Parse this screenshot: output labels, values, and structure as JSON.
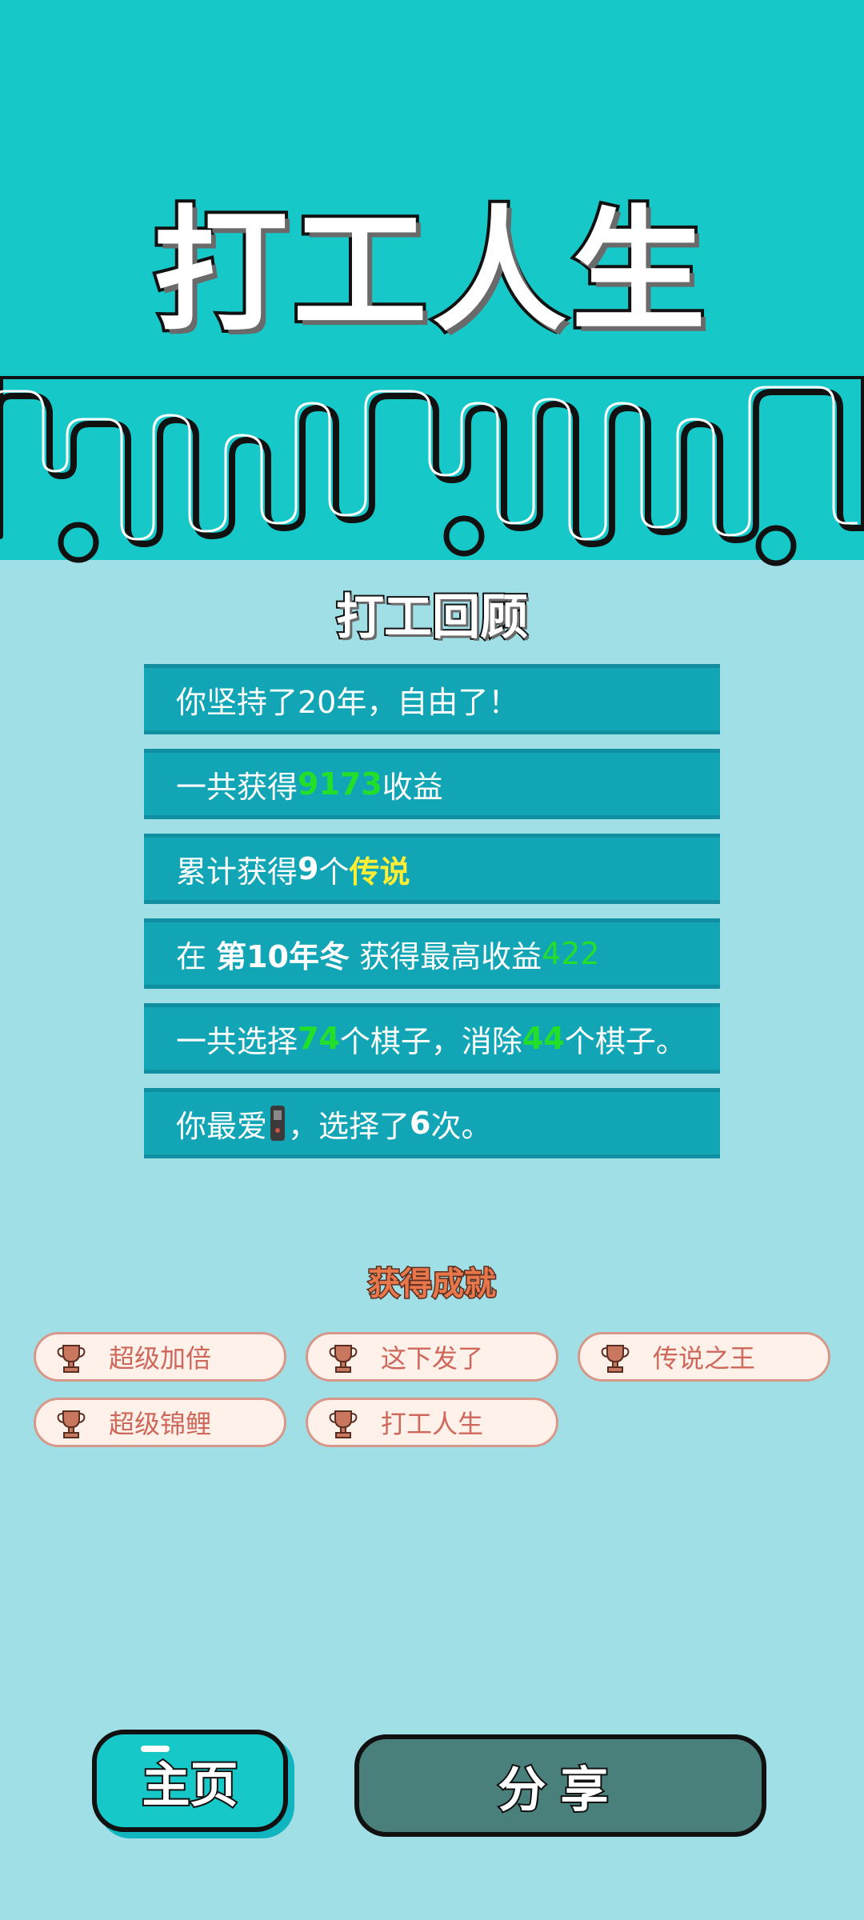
{
  "header": {
    "title": "打工人生"
  },
  "review": {
    "title": "打工回顾",
    "row1": {
      "text": "你坚持了20年，自由了！"
    },
    "row2": {
      "prefix": "一共获得",
      "value": "9173",
      "suffix": "收益"
    },
    "row3": {
      "prefix": "累计获得",
      "count": "9",
      "mid": "个",
      "rarity": "传说"
    },
    "row4": {
      "prefix": "在 ",
      "season": "第10年冬",
      "mid": " 获得最高收益",
      "value": "422"
    },
    "row5": {
      "prefix": "一共选择",
      "chosen": "74",
      "mid": "个棋子，消除",
      "removed": "44",
      "suffix": "个棋子。"
    },
    "row6": {
      "prefix": "你最爱",
      "icon": "phone-icon",
      "mid": "，选择了",
      "count": "6",
      "suffix": "次。"
    }
  },
  "achievements": {
    "title": "获得成就",
    "items": [
      "超级加倍",
      "这下发了",
      "传说之王",
      "超级锦鲤",
      "打工人生"
    ]
  },
  "buttons": {
    "home": "主页",
    "share": "分享"
  },
  "colors": {
    "top_band": "#17c8c8",
    "background": "#9fdfe5",
    "row_bg": "#12a5b6",
    "highlight_green": "#22e02a",
    "highlight_yellow": "#ffee33",
    "badge_text": "#d0675b",
    "share_button": "#4a807c"
  }
}
